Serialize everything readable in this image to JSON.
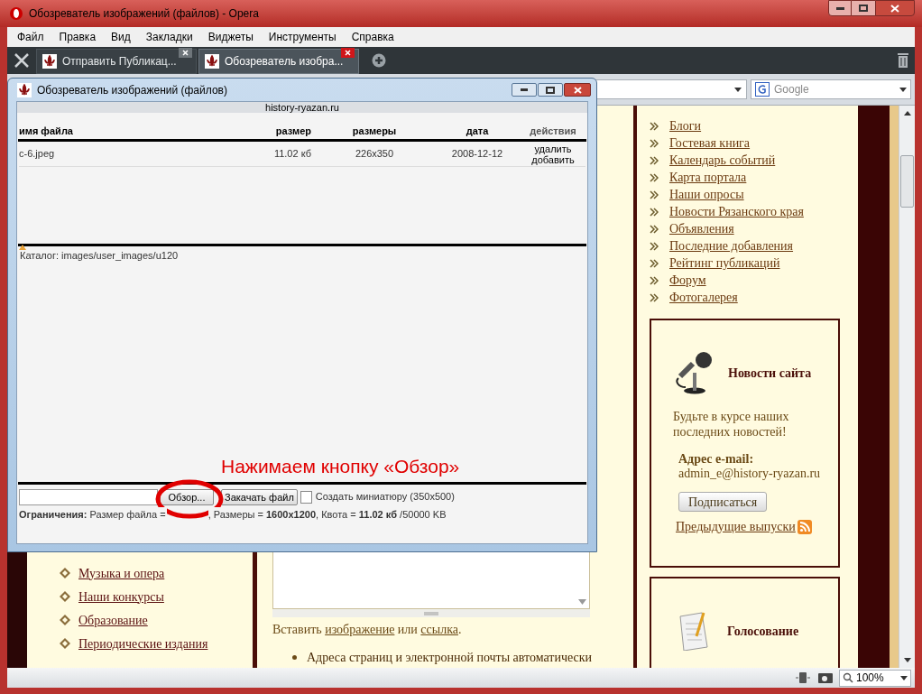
{
  "window": {
    "title": "Обозреватель изображений (файлов) - Opera"
  },
  "menu": [
    "Файл",
    "Правка",
    "Вид",
    "Закладки",
    "Виджеты",
    "Инструменты",
    "Справка"
  ],
  "tabs": [
    {
      "label": "Отправить Публикац...",
      "selected": false
    },
    {
      "label": "Обозреватель изобра...",
      "selected": true
    }
  ],
  "search": {
    "placeholder": "Google"
  },
  "page": {
    "left_links": [
      "Музыка и опера",
      "Наши конкурсы",
      "Образование",
      "Периодические издания"
    ],
    "insert_line": {
      "prefix": "Вставить",
      "link_1": "изображение",
      "joiner": "или",
      "link_2": "ссылка",
      "suffix": "."
    },
    "bullet": "Адреса страниц и электронной почты автоматически",
    "nav_links": [
      "Блоги",
      "Гостевая книга",
      "Календарь событий",
      "Карта портала",
      "Наши опросы",
      "Новости Рязанского края",
      "Объявления",
      "Последние добавления",
      "Рейтинг публикаций",
      "Форум",
      "Фотогалерея"
    ],
    "news": {
      "title": "Новости сайта",
      "text": "Будьте в курсе наших последних новостей!",
      "email_label": "Адрес e-mail:",
      "email": "admin_e@history-ryazan.ru",
      "subscribe": "Подписаться",
      "archive_link": "Предыдущие выпуски"
    },
    "poll": {
      "title": "Голосование"
    }
  },
  "status_bar": {
    "zoom": "100%"
  },
  "dialog": {
    "title": "Обозреватель изображений (файлов)",
    "site": "history-ryazan.ru",
    "columns": [
      "имя файла",
      "размер",
      "размеры",
      "дата",
      "действия"
    ],
    "rows": [
      {
        "name": "c-6.jpeg",
        "size": "11.02 кб",
        "dimensions": "226x350",
        "date": "2008-12-12",
        "actions": [
          "удалить",
          "добавить"
        ]
      }
    ],
    "catalog": "Каталог: images/user_images/u120",
    "annotation": "Нажимаем кнопку «Обзор»",
    "browse_button": "Обзор...",
    "upload_button": "Закачать файл",
    "thumbnail": {
      "label": "Создать миниатюру (350x500)",
      "checked": false
    },
    "limits": [
      "**Ограничения:** Размер файла =",
      ", Размеры = **1600x1200**, Квота = **11.02 кб** /50000 KB"
    ]
  }
}
